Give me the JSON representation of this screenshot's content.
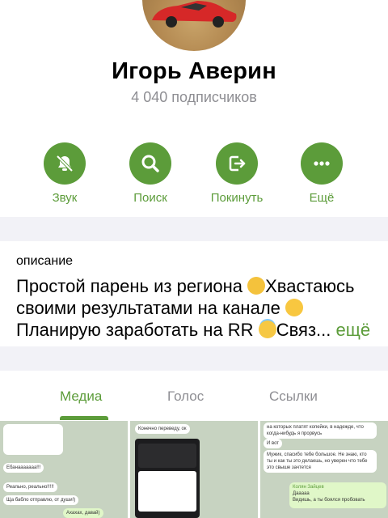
{
  "profile": {
    "name": "Игорь Аверин",
    "subscribers": "4 040 подписчиков"
  },
  "actions": [
    {
      "label": "Звук",
      "icon": "bell-slash-icon"
    },
    {
      "label": "Поиск",
      "icon": "search-icon"
    },
    {
      "label": "Покинуть",
      "icon": "leave-icon"
    },
    {
      "label": "Ещё",
      "icon": "more-icon"
    }
  ],
  "description": {
    "caption": "описание",
    "line1": "Простой парень из региона",
    "line1b": "Хвастаюсь",
    "line2": "своими результатами на канале",
    "line3": "Планирую заработать на RR",
    "line3b": "Связ...",
    "more": "ещё"
  },
  "tabs": [
    {
      "label": "Медиа",
      "active": true
    },
    {
      "label": "Голос",
      "active": false
    },
    {
      "label": "Ссылки",
      "active": false
    }
  ],
  "media": {
    "thumb1": {
      "b1": "Ебанааааааа!!!",
      "b2": "Реально, реально!!!!!",
      "b3": "Ща бабло отправлю, от души!)",
      "b4": "Ахахах, давай)"
    },
    "thumb2": {
      "b1": "Конечно переведу, ок"
    },
    "thumb3": {
      "b1": "на которых платят копейки, в надежде, что когда-нибудь я прорвусь",
      "b2": "И вот",
      "b3": "Мужик, спасибо тебе большое. Не знаю, кто ты и как ты это делаешь, но уверен что тебе это свыше зачтется",
      "b4": "Колян Зайцев",
      "b5": "Дааааа",
      "b6": "Видишь, а ты боялся пробовать"
    }
  },
  "colors": {
    "accent": "#5c9c3a",
    "secondary_text": "#8e8e93",
    "background": "#f2f2f7"
  }
}
